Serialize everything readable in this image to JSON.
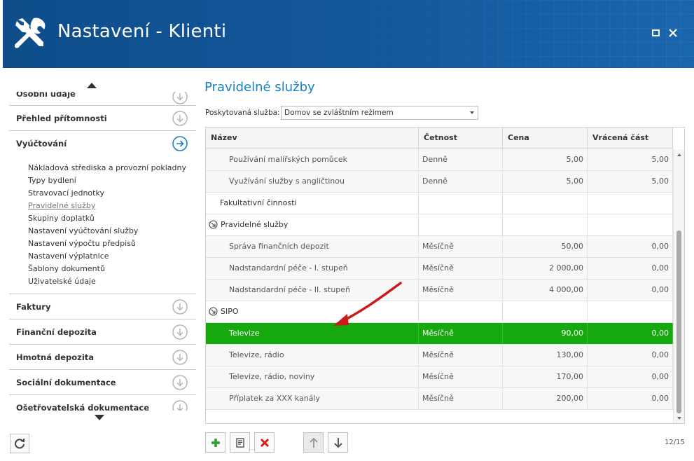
{
  "window": {
    "title": "Nastavení - Klienti",
    "icon": "wrench-screwdriver-icon"
  },
  "sidebar": {
    "sections": [
      {
        "label": "Osobní údaje",
        "icon": "chevron-down-circle-icon"
      },
      {
        "label": "Přehled přítomnosti",
        "icon": "chevron-down-circle-icon"
      },
      {
        "label": "Vyúčtování",
        "icon": "chevron-right-circle-icon",
        "expanded": true
      },
      {
        "label": "Faktury",
        "icon": "chevron-down-circle-icon"
      },
      {
        "label": "Finanční depozita",
        "icon": "chevron-down-circle-icon"
      },
      {
        "label": "Hmotná depozita",
        "icon": "chevron-down-circle-icon"
      },
      {
        "label": "Sociální dokumentace",
        "icon": "chevron-down-circle-icon"
      },
      {
        "label": "Ošetřovatelská dokumentace",
        "icon": "chevron-down-circle-icon"
      }
    ],
    "sub_items": [
      "Nákladová střediska a provozní pokladny",
      "Typy bydlení",
      "Stravovací jednotky",
      "Pravidelné služby",
      "Skupiny doplatků",
      "Nastavení vyúčtování služby",
      "Nastavení výpočtu předpisů",
      "Nastavení výplatnice",
      "Šablony dokumentů",
      "Uživatelské údaje"
    ],
    "active_sub_item": "Pravidelné služby"
  },
  "main": {
    "title": "Pravidelné služby",
    "service_label": "Poskytovaná služba:",
    "service_value": "Domov se zvláštním režimem",
    "columns": [
      "Název",
      "Četnost",
      "Cena",
      "Vrácená část"
    ],
    "rows": [
      {
        "type": "item",
        "name": "Používání malířských pomůcek",
        "freq": "Denně",
        "price": "5,00",
        "refund": "5,00"
      },
      {
        "type": "item",
        "name": "Využívání služby s angličtinou",
        "freq": "Denně",
        "price": "5,00",
        "refund": "5,00"
      },
      {
        "type": "group",
        "name": "Fakultativní činnosti",
        "freq": "",
        "price": "",
        "refund": ""
      },
      {
        "type": "group-icon",
        "name": "Pravidelné služby",
        "freq": "",
        "price": "",
        "refund": ""
      },
      {
        "type": "item",
        "name": "Správa finančních depozit",
        "freq": "Měsíčně",
        "price": "50,00",
        "refund": "0,00"
      },
      {
        "type": "item",
        "name": "Nadstandardní péče - I. stupeň",
        "freq": "Měsíčně",
        "price": "2 000,00",
        "refund": "0,00"
      },
      {
        "type": "item",
        "name": "Nadstandardní péče - II. stupeň",
        "freq": "Měsíčně",
        "price": "4 000,00",
        "refund": "0,00"
      },
      {
        "type": "group-icon",
        "name": "SIPO",
        "freq": "",
        "price": "",
        "refund": ""
      },
      {
        "type": "item",
        "selected": true,
        "name": "Televize",
        "freq": "Měsíčně",
        "price": "90,00",
        "refund": "0,00"
      },
      {
        "type": "item",
        "name": "Televize, rádio",
        "freq": "Měsíčně",
        "price": "130,00",
        "refund": "0,00"
      },
      {
        "type": "item",
        "name": "Televize, rádio, noviny",
        "freq": "Měsíčně",
        "price": "170,00",
        "refund": "0,00"
      },
      {
        "type": "item",
        "name": "Příplatek za XXX kanály",
        "freq": "Měsíčně",
        "price": "200,00",
        "refund": "0,00"
      }
    ],
    "pager": "12/15",
    "colors": {
      "accent": "#1683c6",
      "header": "#13589c",
      "selected_row": "#16a90e",
      "annotation_arrow": "#cc1a1a"
    }
  }
}
